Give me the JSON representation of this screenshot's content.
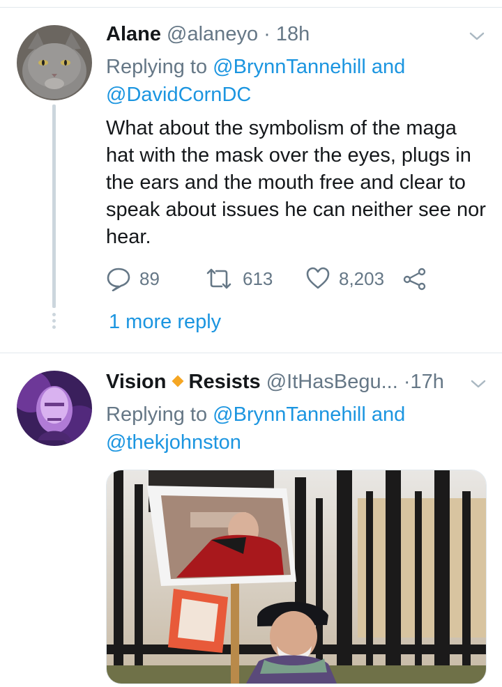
{
  "tweet1": {
    "name": "Alane",
    "handle": "@alaneyo",
    "separator": "·",
    "time": "18h",
    "replying_prefix": "Replying to",
    "reply_mention1": "@BrynnTannehill",
    "reply_and": "and",
    "reply_mention2": "@DavidCornDC",
    "text": "What about the symbolism of the maga hat with the mask over the eyes, plugs in the ears and the mouth free and clear to speak about issues he can neither see nor hear.",
    "replies_count": "89",
    "retweets_count": "613",
    "likes_count": "8,203",
    "more_reply": "1 more reply"
  },
  "tweet2": {
    "name_part1": "Vision",
    "name_part2": "Resists",
    "handle": "@ItHasBegu...",
    "separator": "·",
    "time": "17h",
    "replying_prefix": "Replying to",
    "reply_mention1": "@BrynnTannehill",
    "reply_and": "and",
    "reply_mention2": "@thekjohnston"
  },
  "icons": {
    "reply": "speech-bubble-icon",
    "retweet": "retweet-arrows-icon",
    "like": "heart-icon",
    "share": "share-nodes-icon",
    "caret": "chevron-down-icon"
  },
  "colors": {
    "link": "#1b95e0",
    "secondary_text": "#657786",
    "diamond": "#f5a623"
  }
}
